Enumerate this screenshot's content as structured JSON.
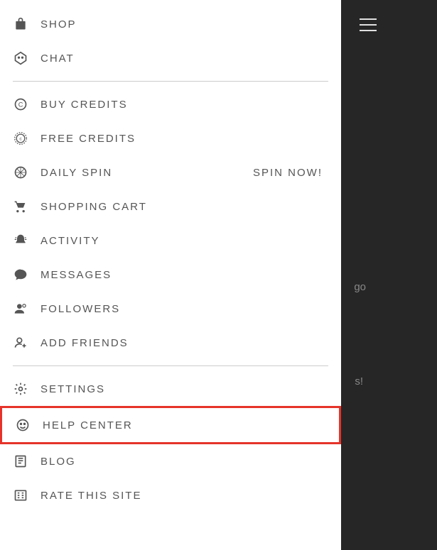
{
  "menu": {
    "section1": [
      {
        "label": "SHOP",
        "icon": "shop"
      },
      {
        "label": "CHAT",
        "icon": "chat"
      }
    ],
    "section2": [
      {
        "label": "BUY CREDITS",
        "icon": "buy-credits"
      },
      {
        "label": "FREE CREDITS",
        "icon": "free-credits"
      },
      {
        "label": "DAILY SPIN",
        "icon": "daily-spin",
        "badge": "SPIN NOW!"
      },
      {
        "label": "SHOPPING CART",
        "icon": "cart"
      },
      {
        "label": "ACTIVITY",
        "icon": "activity"
      },
      {
        "label": "MESSAGES",
        "icon": "messages"
      },
      {
        "label": "FOLLOWERS",
        "icon": "followers"
      },
      {
        "label": "ADD FRIENDS",
        "icon": "add-friends"
      }
    ],
    "section3": [
      {
        "label": "SETTINGS",
        "icon": "settings"
      },
      {
        "label": "HELP CENTER",
        "icon": "help",
        "highlighted": true
      },
      {
        "label": "BLOG",
        "icon": "blog"
      },
      {
        "label": "RATE THIS SITE",
        "icon": "rate"
      }
    ]
  },
  "background": {
    "text1": "go",
    "text2": "s!"
  }
}
